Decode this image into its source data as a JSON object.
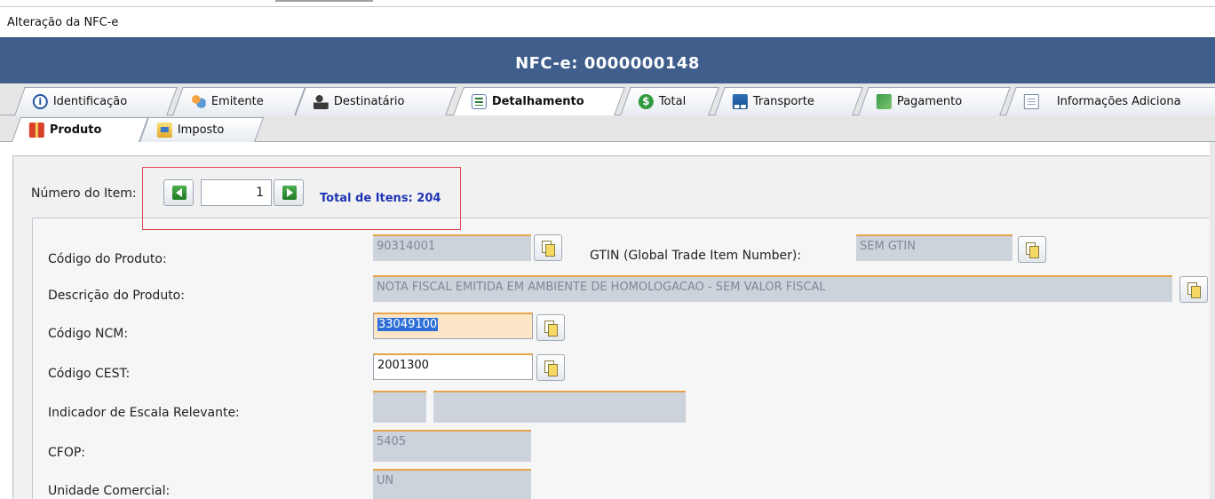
{
  "window": {
    "title": "Alteração da NFC-e"
  },
  "header": {
    "title": "NFC-e: 0000000148"
  },
  "tabs": [
    {
      "label": "Identificação",
      "icon": "info-icon"
    },
    {
      "label": "Emitente",
      "icon": "people-icon"
    },
    {
      "label": "Destinatário",
      "icon": "person-icon"
    },
    {
      "label": "Detalhamento",
      "icon": "detail-icon",
      "active": true
    },
    {
      "label": "Total",
      "icon": "dollar-icon"
    },
    {
      "label": "Transporte",
      "icon": "truck-icon"
    },
    {
      "label": "Pagamento",
      "icon": "money-icon"
    },
    {
      "label": "Informações Adiciona",
      "icon": "document-icon"
    }
  ],
  "subtabs": [
    {
      "label": "Produto",
      "icon": "gift-icon",
      "active": true
    },
    {
      "label": "Imposto",
      "icon": "imposto-icon"
    }
  ],
  "item_nav": {
    "label": "Número do Item:",
    "value": "1",
    "total_label": "Total de Itens: 204"
  },
  "fields": {
    "codigo_produto": {
      "label": "Código do Produto:",
      "value": "90314001"
    },
    "gtin": {
      "label": "GTIN (Global Trade Item Number):",
      "value": "SEM GTIN"
    },
    "descricao": {
      "label": "Descrição do Produto:",
      "value": "NOTA FISCAL EMITIDA EM AMBIENTE DE HOMOLOGACAO - SEM VALOR FISCAL"
    },
    "ncm": {
      "label": "Código NCM:",
      "value": "33049100"
    },
    "cest": {
      "label": "Código CEST:",
      "value": "2001300"
    },
    "escala": {
      "label": "Indicador de Escala Relevante:",
      "value1": "",
      "value2": ""
    },
    "cfop": {
      "label": "CFOP:",
      "value": "5405"
    },
    "unidade": {
      "label": "Unidade Comercial:",
      "value": "UN"
    }
  },
  "colors": {
    "header_bg": "#3f5e8c",
    "accent_border": "#e8a44a",
    "total_text": "#1f35b5",
    "highlight_box": "#e0474f"
  }
}
